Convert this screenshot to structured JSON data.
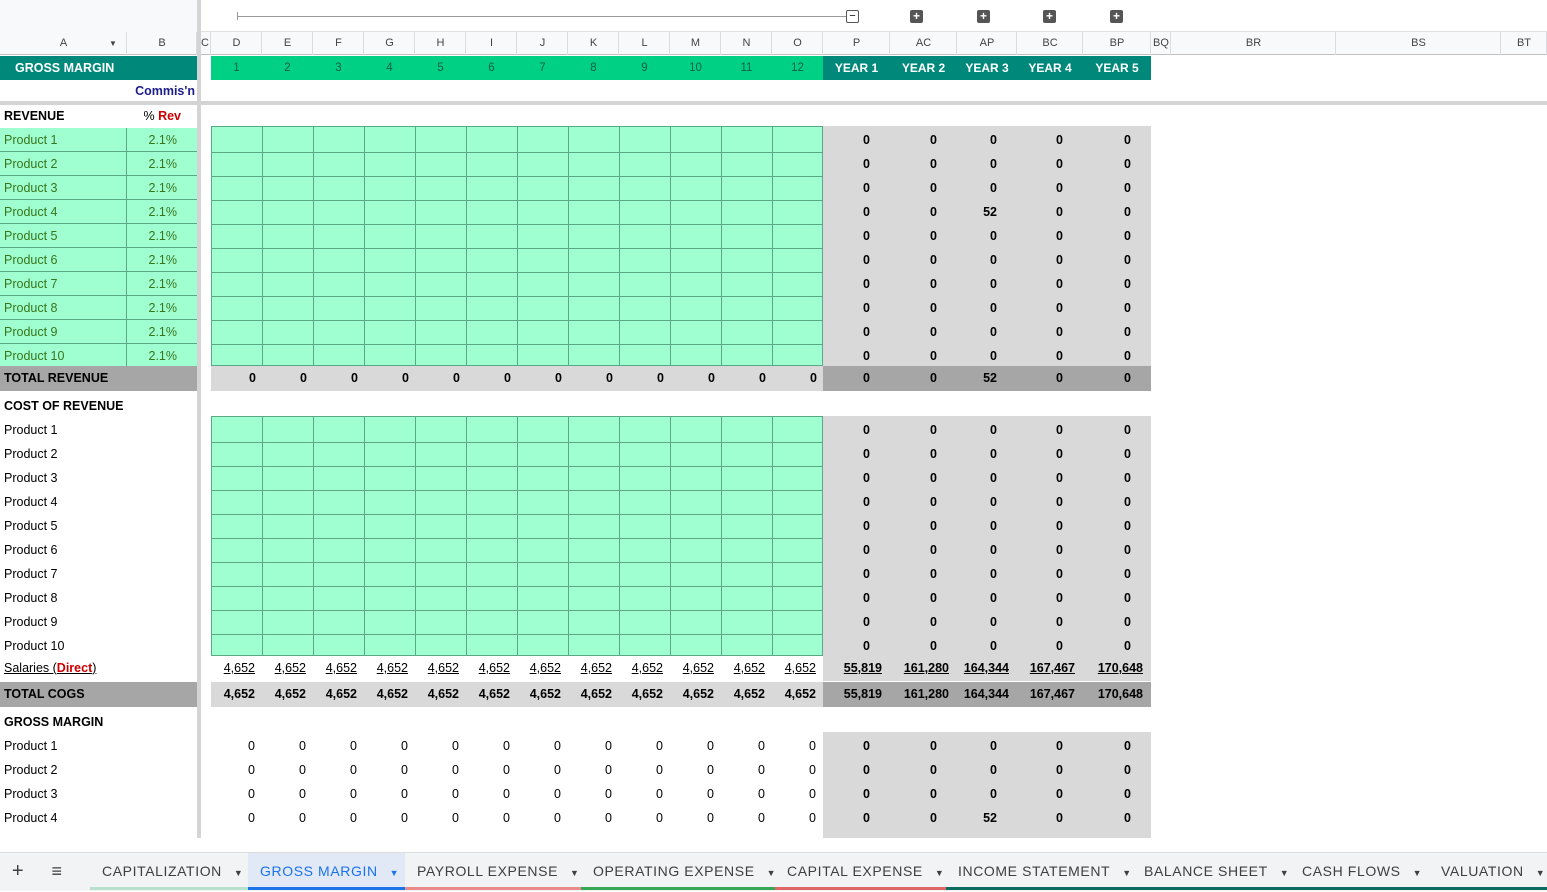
{
  "columns": {
    "a": "A",
    "b": "B",
    "c": "C",
    "months": [
      "D",
      "E",
      "F",
      "G",
      "H",
      "I",
      "J",
      "K",
      "L",
      "M",
      "N",
      "O"
    ],
    "p": "P",
    "years": [
      "AC",
      "AP",
      "BC",
      "BP"
    ],
    "extra": [
      "BQ",
      "BR",
      "BS",
      "BT"
    ]
  },
  "header": {
    "title": "GROSS MARGIN",
    "commission_label": "Commis'n",
    "months": [
      "1",
      "2",
      "3",
      "4",
      "5",
      "6",
      "7",
      "8",
      "9",
      "10",
      "11",
      "12"
    ],
    "years": [
      "YEAR 1",
      "YEAR 2",
      "YEAR 3",
      "YEAR 4",
      "YEAR 5"
    ]
  },
  "revenue": {
    "title": "REVENUE",
    "pct_prefix": "% ",
    "pct_suffix": "Rev",
    "rows": [
      {
        "label": "Product 1",
        "pct": "2.1%",
        "years": [
          "0",
          "0",
          "0",
          "0",
          "0"
        ]
      },
      {
        "label": "Product 2",
        "pct": "2.1%",
        "years": [
          "0",
          "0",
          "0",
          "0",
          "0"
        ]
      },
      {
        "label": "Product 3",
        "pct": "2.1%",
        "years": [
          "0",
          "0",
          "0",
          "0",
          "0"
        ]
      },
      {
        "label": "Product 4",
        "pct": "2.1%",
        "years": [
          "0",
          "0",
          "52",
          "0",
          "0"
        ]
      },
      {
        "label": "Product 5",
        "pct": "2.1%",
        "years": [
          "0",
          "0",
          "0",
          "0",
          "0"
        ]
      },
      {
        "label": "Product 6",
        "pct": "2.1%",
        "years": [
          "0",
          "0",
          "0",
          "0",
          "0"
        ]
      },
      {
        "label": "Product 7",
        "pct": "2.1%",
        "years": [
          "0",
          "0",
          "0",
          "0",
          "0"
        ]
      },
      {
        "label": "Product 8",
        "pct": "2.1%",
        "years": [
          "0",
          "0",
          "0",
          "0",
          "0"
        ]
      },
      {
        "label": "Product 9",
        "pct": "2.1%",
        "years": [
          "0",
          "0",
          "0",
          "0",
          "0"
        ]
      },
      {
        "label": "Product 10",
        "pct": "2.1%",
        "years": [
          "0",
          "0",
          "0",
          "0",
          "0"
        ]
      }
    ],
    "total": {
      "label": "TOTAL REVENUE",
      "months": [
        "0",
        "0",
        "0",
        "0",
        "0",
        "0",
        "0",
        "0",
        "0",
        "0",
        "0",
        "0"
      ],
      "years": [
        "0",
        "0",
        "52",
        "0",
        "0"
      ]
    }
  },
  "cost": {
    "title": "COST OF REVENUE",
    "rows": [
      {
        "label": "Product 1",
        "years": [
          "0",
          "0",
          "0",
          "0",
          "0"
        ]
      },
      {
        "label": "Product 2",
        "years": [
          "0",
          "0",
          "0",
          "0",
          "0"
        ]
      },
      {
        "label": "Product 3",
        "years": [
          "0",
          "0",
          "0",
          "0",
          "0"
        ]
      },
      {
        "label": "Product 4",
        "years": [
          "0",
          "0",
          "0",
          "0",
          "0"
        ]
      },
      {
        "label": "Product 5",
        "years": [
          "0",
          "0",
          "0",
          "0",
          "0"
        ]
      },
      {
        "label": "Product 6",
        "years": [
          "0",
          "0",
          "0",
          "0",
          "0"
        ]
      },
      {
        "label": "Product 7",
        "years": [
          "0",
          "0",
          "0",
          "0",
          "0"
        ]
      },
      {
        "label": "Product 8",
        "years": [
          "0",
          "0",
          "0",
          "0",
          "0"
        ]
      },
      {
        "label": "Product 9",
        "years": [
          "0",
          "0",
          "0",
          "0",
          "0"
        ]
      },
      {
        "label": "Product 10",
        "years": [
          "0",
          "0",
          "0",
          "0",
          "0"
        ]
      }
    ],
    "salaries": {
      "label_prefix": "Salaries (",
      "label_link": "Direct",
      "label_suffix": ")",
      "months": [
        "4,652",
        "4,652",
        "4,652",
        "4,652",
        "4,652",
        "4,652",
        "4,652",
        "4,652",
        "4,652",
        "4,652",
        "4,652",
        "4,652"
      ],
      "years": [
        "55,819",
        "161,280",
        "164,344",
        "167,467",
        "170,648"
      ]
    },
    "total": {
      "label": "TOTAL COGS",
      "months": [
        "4,652",
        "4,652",
        "4,652",
        "4,652",
        "4,652",
        "4,652",
        "4,652",
        "4,652",
        "4,652",
        "4,652",
        "4,652",
        "4,652"
      ],
      "years": [
        "55,819",
        "161,280",
        "164,344",
        "167,467",
        "170,648"
      ]
    }
  },
  "gross_margin": {
    "title": "GROSS MARGIN",
    "rows": [
      {
        "label": "Product 1",
        "months": [
          "0",
          "0",
          "0",
          "0",
          "0",
          "0",
          "0",
          "0",
          "0",
          "0",
          "0",
          "0"
        ],
        "years": [
          "0",
          "0",
          "0",
          "0",
          "0"
        ]
      },
      {
        "label": "Product 2",
        "months": [
          "0",
          "0",
          "0",
          "0",
          "0",
          "0",
          "0",
          "0",
          "0",
          "0",
          "0",
          "0"
        ],
        "years": [
          "0",
          "0",
          "0",
          "0",
          "0"
        ]
      },
      {
        "label": "Product 3",
        "months": [
          "0",
          "0",
          "0",
          "0",
          "0",
          "0",
          "0",
          "0",
          "0",
          "0",
          "0",
          "0"
        ],
        "years": [
          "0",
          "0",
          "0",
          "0",
          "0"
        ]
      },
      {
        "label": "Product 4",
        "months": [
          "0",
          "0",
          "0",
          "0",
          "0",
          "0",
          "0",
          "0",
          "0",
          "0",
          "0",
          "0"
        ],
        "years": [
          "0",
          "0",
          "52",
          "0",
          "0"
        ]
      }
    ]
  },
  "tabs": [
    {
      "label": "CAPITALIZATION",
      "color": "#b7e1cd",
      "active": false
    },
    {
      "label": "GROSS MARGIN",
      "color": "#1a73e8",
      "active": true
    },
    {
      "label": "PAYROLL EXPENSE",
      "color": "#ea8a8a",
      "active": false
    },
    {
      "label": "OPERATING EXPENSE",
      "color": "#34a853",
      "active": false
    },
    {
      "label": "CAPITAL EXPENSE",
      "color": "#e06666",
      "active": false
    },
    {
      "label": "INCOME STATEMENT",
      "color": "#0b6b5e",
      "active": false
    },
    {
      "label": "BALANCE SHEET",
      "color": "#0b6b5e",
      "active": false
    },
    {
      "label": "CASH FLOWS",
      "color": "#0b6b5e",
      "active": false
    },
    {
      "label": "VALUATION",
      "color": "#0b6b5e",
      "active": false
    }
  ],
  "colors": {
    "teal": "#00897b",
    "mint": "#00d084",
    "input_green": "#9fffd0",
    "grey_fill": "#d9d9d9",
    "total_grey": "#a6a6a6",
    "product_label": "#38761d",
    "navy": "#1c1c8a",
    "red": "#cc0000"
  },
  "icons": {
    "add_sheet": "+",
    "all_sheets": "≡",
    "group_collapse": "−",
    "group_expand": "+",
    "filter": "▼"
  }
}
